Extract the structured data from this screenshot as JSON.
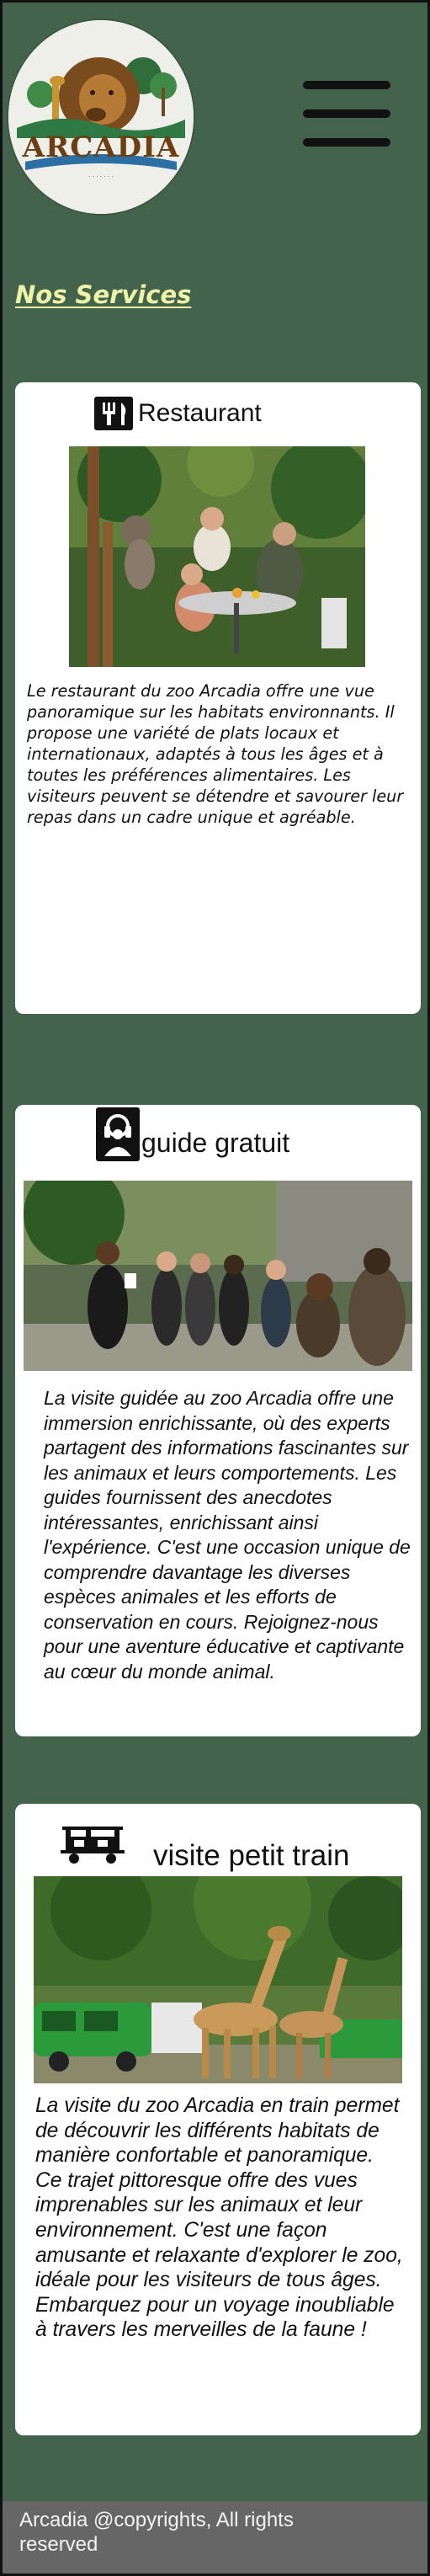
{
  "header": {
    "logo_text": "ARCADIA",
    "menu_icon": "hamburger-menu-icon"
  },
  "services": {
    "title": "Nos Services",
    "items": [
      {
        "icon": "fork-knife-icon",
        "title": "Restaurant",
        "image": "restaurant-photo",
        "description": "Le restaurant du zoo Arcadia offre une vue panoramique sur les habitats environnants. Il propose une variété de plats locaux et internationaux, adaptés à tous les âges et à toutes les préférences alimentaires. Les visiteurs peuvent se détendre et savourer leur repas dans un cadre unique et agréable."
      },
      {
        "icon": "guide-headset-icon",
        "title": "guide gratuit",
        "image": "guided-tour-photo",
        "description": "La visite guidée au zoo Arcadia offre une immersion enrichissante, où des experts partagent des informations fascinantes sur les animaux et leurs comportements. Les guides fournissent des anecdotes intéressantes, enrichissant ainsi l'expérience. C'est une occasion unique de comprendre davantage les diverses espèces animales et les efforts de conservation en cours. Rejoignez-nous pour une aventure éducative et captivante au cœur du monde animal."
      },
      {
        "icon": "train-icon",
        "title": "visite petit train",
        "image": "train-giraffe-photo",
        "description": "La visite du zoo Arcadia en train permet de découvrir les différents habitats de manière confortable et panoramique. Ce trajet pittoresque offre des vues imprenables sur les animaux et leur environnement. C'est une façon amusante et relaxante d'explorer le zoo, idéale pour les visiteurs de tous âges. Embarquez pour un voyage inoubliable à travers les merveilles de la faune !"
      }
    ]
  },
  "footer": {
    "text": "Arcadia @copyrights, All rights reserved"
  },
  "colors": {
    "background": "#44634d",
    "title": "#eef3a6",
    "footer": "#666666"
  }
}
